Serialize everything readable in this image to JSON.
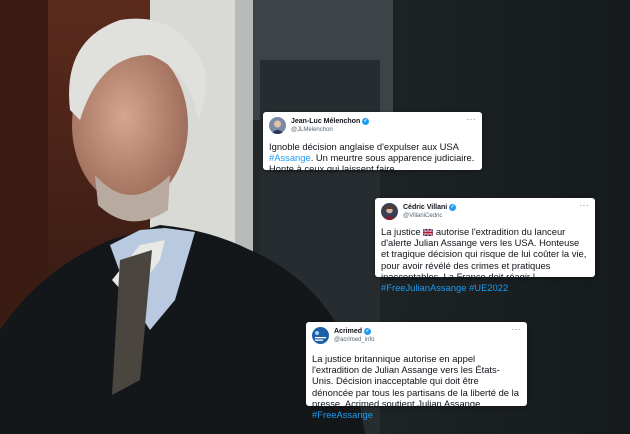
{
  "tweets": [
    {
      "name": "Jean-Luc Mélenchon",
      "handle": "@JLMelenchon",
      "more": "···",
      "line1": "Ignoble décision anglaise d'expulser aux USA",
      "hashtag1": "#Assange",
      "line2": ". Un meurtre sous apparence judiciaire.",
      "line3": "Honte à ceux qui laissent faire."
    },
    {
      "name": "Cédric Villani",
      "handle": "@VillaniCedric",
      "more": "···",
      "text_before_flag": "La justice",
      "flag_icon": "uk-flag-icon",
      "text_after_flag": "autorise l'extradition du lanceur d'alerte Julian Assange vers les USA. Honteuse et tragique décision qui risque de lui coûter la vie, pour avoir révélé des crimes et pratiques inacceptables. La France doit réagir !",
      "hashtag1": "#FreeJulianAssange",
      "hashtag2": "#UE2022"
    },
    {
      "name": "Acrimed",
      "handle": "@acrimed_info",
      "more": "···",
      "text": "La justice britannique autorise en appel l'extradition de Julian Assange vers les États-Unis. Décision inacceptable qui doit être dénoncée par tous les partisans de la liberté de la presse. Acrimed soutient Julian Assange.",
      "hashtag1": "#FreeAssange"
    }
  ],
  "colors": {
    "accent": "#1d9bf0",
    "text": "#0f1419",
    "muted": "#536471"
  }
}
